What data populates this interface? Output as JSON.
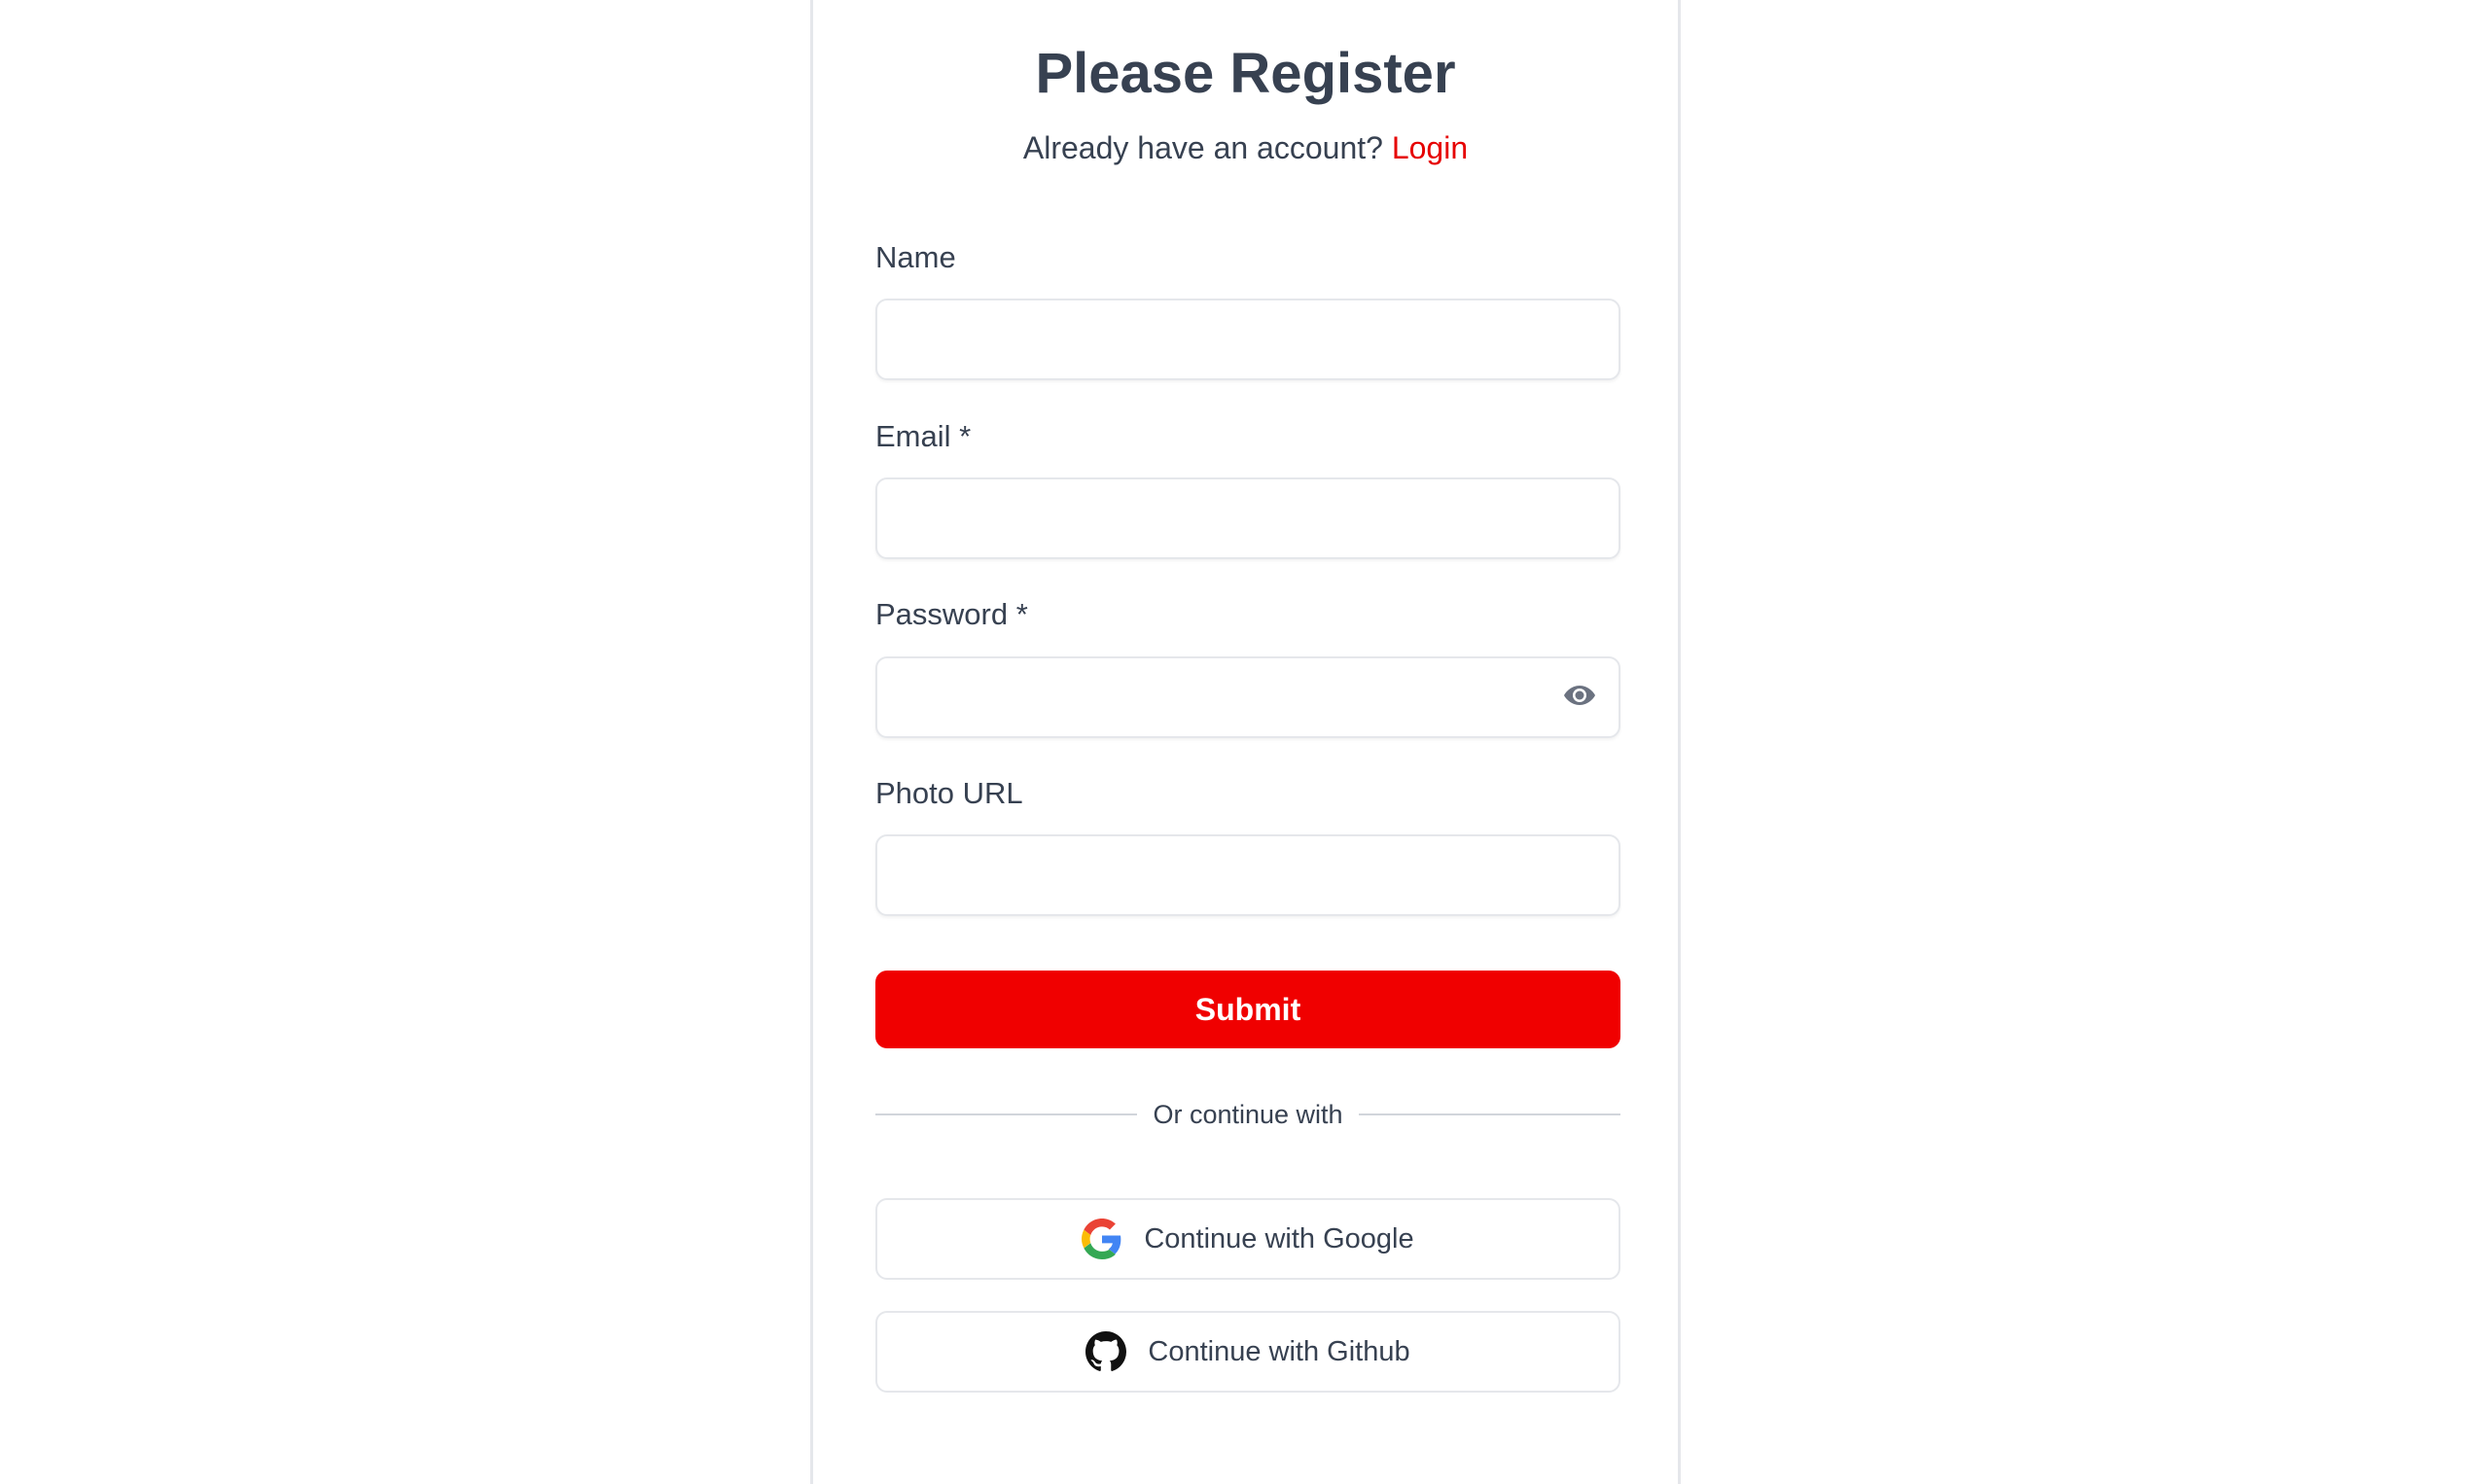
{
  "header": {
    "title": "Please Register",
    "subtitle_text": "Already have an account?",
    "login_link": "Login"
  },
  "form": {
    "name": {
      "label": "Name",
      "value": "",
      "placeholder": ""
    },
    "email": {
      "label": "Email *",
      "value": "",
      "placeholder": ""
    },
    "password": {
      "label": "Password *",
      "value": "",
      "placeholder": "",
      "toggle_icon": "eye-icon"
    },
    "photo_url": {
      "label": "Photo URL",
      "value": "",
      "placeholder": ""
    },
    "submit_label": "Submit"
  },
  "divider": {
    "text": "Or continue with"
  },
  "social": {
    "google": {
      "label": "Continue with Google",
      "icon": "google-icon"
    },
    "github": {
      "label": "Continue with Github",
      "icon": "github-icon"
    }
  },
  "colors": {
    "accent": "#f00000",
    "link": "#e60000",
    "text": "#374151",
    "border": "#e5e7eb"
  }
}
